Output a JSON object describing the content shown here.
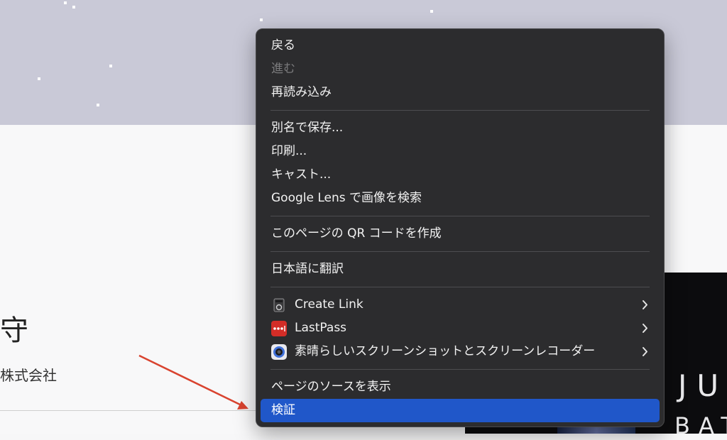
{
  "page": {
    "heading": "守",
    "company": "株式会社",
    "panel_text_1": "JU",
    "panel_text_2": "BAT"
  },
  "context_menu": {
    "groups": [
      [
        {
          "label": "戻る",
          "enabled": true
        },
        {
          "label": "進む",
          "enabled": false
        },
        {
          "label": "再読み込み",
          "enabled": true
        }
      ],
      [
        {
          "label": "別名で保存...",
          "enabled": true
        },
        {
          "label": "印刷...",
          "enabled": true
        },
        {
          "label": "キャスト...",
          "enabled": true
        },
        {
          "label": "Google Lens で画像を検索",
          "enabled": true
        }
      ],
      [
        {
          "label": "このページの QR コードを作成",
          "enabled": true
        }
      ],
      [
        {
          "label": "日本語に翻訳",
          "enabled": true
        }
      ],
      [
        {
          "label": "Create Link",
          "icon": "create-link-extension-icon",
          "submenu": true
        },
        {
          "label": "LastPass",
          "icon": "lastpass-icon",
          "submenu": true
        },
        {
          "label": "素晴らしいスクリーンショットとスクリーンレコーダー",
          "icon": "awesome-screenshot-icon",
          "submenu": true
        }
      ],
      [
        {
          "label": "ページのソースを表示",
          "enabled": true
        },
        {
          "label": "検証",
          "enabled": true,
          "selected": true
        }
      ]
    ]
  },
  "colors": {
    "menu_background": "#2c2c2e",
    "menu_highlight": "#2057c9",
    "lastpass_red": "#d32d27",
    "arrow_red": "#d9432f"
  }
}
